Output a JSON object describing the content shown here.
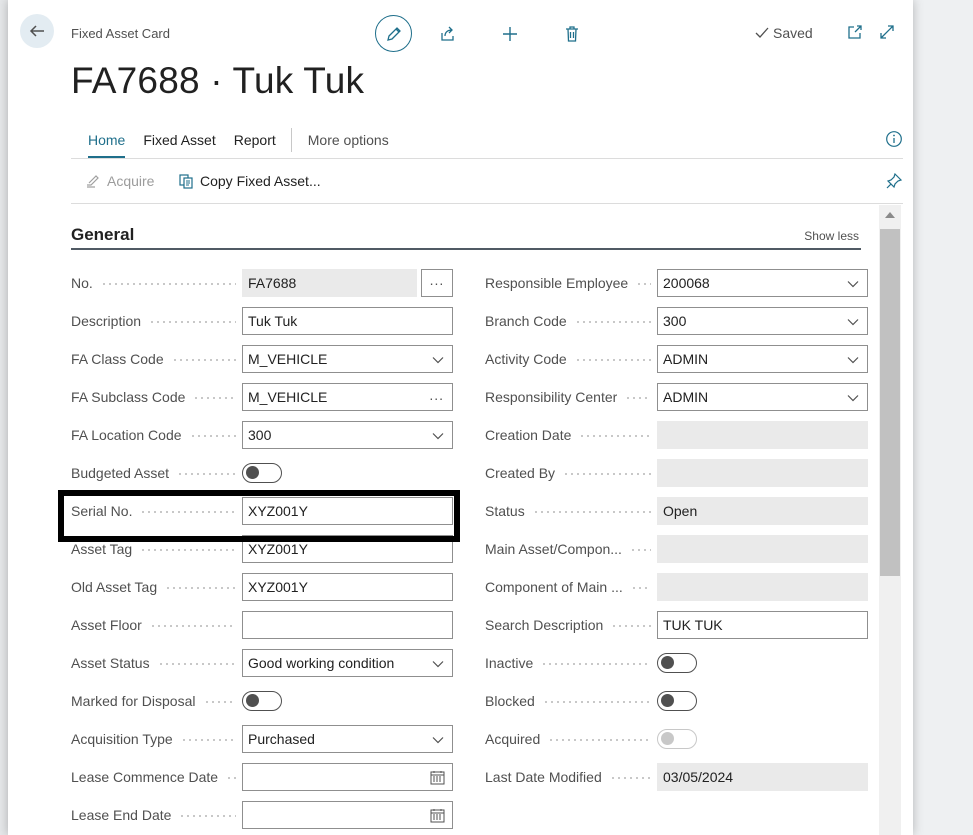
{
  "header": {
    "breadcrumb": "Fixed Asset Card",
    "title": "FA7688 · Tuk Tuk",
    "saved_label": "Saved"
  },
  "tabs": [
    {
      "label": "Home",
      "active": true
    },
    {
      "label": "Fixed Asset",
      "active": false
    },
    {
      "label": "Report",
      "active": false
    },
    {
      "label": "More options",
      "active": false
    }
  ],
  "actions": {
    "acquire": "Acquire",
    "copy": "Copy Fixed Asset..."
  },
  "section": {
    "title": "General",
    "toggle_label": "Show less"
  },
  "left_fields": [
    {
      "label": "No.",
      "value": "FA7688",
      "kind": "readonly-assist"
    },
    {
      "label": "Description",
      "value": "Tuk Tuk",
      "kind": "text"
    },
    {
      "label": "FA Class Code",
      "value": "M_VEHICLE",
      "kind": "dropdown"
    },
    {
      "label": "FA Subclass Code",
      "value": "M_VEHICLE",
      "kind": "lookup"
    },
    {
      "label": "FA Location Code",
      "value": "300",
      "kind": "dropdown"
    },
    {
      "label": "Budgeted Asset",
      "value": "",
      "kind": "toggle"
    },
    {
      "label": "Serial No.",
      "value": "XYZ001Y",
      "kind": "text"
    },
    {
      "label": "Asset Tag",
      "value": "XYZ001Y",
      "kind": "text"
    },
    {
      "label": "Old Asset Tag",
      "value": "XYZ001Y",
      "kind": "text"
    },
    {
      "label": "Asset Floor",
      "value": "",
      "kind": "text"
    },
    {
      "label": "Asset Status",
      "value": "Good working condition",
      "kind": "dropdown"
    },
    {
      "label": "Marked for Disposal",
      "value": "",
      "kind": "toggle"
    },
    {
      "label": "Acquisition Type",
      "value": "Purchased",
      "kind": "dropdown"
    },
    {
      "label": "Lease Commence Date",
      "value": "",
      "kind": "date"
    },
    {
      "label": "Lease End Date",
      "value": "",
      "kind": "date"
    }
  ],
  "right_fields": [
    {
      "label": "Responsible Employee",
      "value": "200068",
      "kind": "dropdown"
    },
    {
      "label": "Branch Code",
      "value": "300",
      "kind": "dropdown"
    },
    {
      "label": "Activity Code",
      "value": "ADMIN",
      "kind": "dropdown"
    },
    {
      "label": "Responsibility Center",
      "value": "ADMIN",
      "kind": "dropdown"
    },
    {
      "label": "Creation Date",
      "value": "",
      "kind": "readonly"
    },
    {
      "label": "Created By",
      "value": "",
      "kind": "readonly"
    },
    {
      "label": "Status",
      "value": "Open",
      "kind": "readonly"
    },
    {
      "label": "Main Asset/Compon...",
      "value": "",
      "kind": "readonly"
    },
    {
      "label": "Component of Main ...",
      "value": "",
      "kind": "readonly"
    },
    {
      "label": "Search Description",
      "value": "TUK TUK",
      "kind": "text"
    },
    {
      "label": "Inactive",
      "value": "",
      "kind": "toggle"
    },
    {
      "label": "Blocked",
      "value": "",
      "kind": "toggle"
    },
    {
      "label": "Acquired",
      "value": "",
      "kind": "toggle-disabled"
    },
    {
      "label": "Last Date Modified",
      "value": "03/05/2024",
      "kind": "readonly"
    }
  ],
  "icons": {
    "back": "arrow-left-icon",
    "edit": "pencil-icon",
    "share": "share-icon",
    "new": "plus-icon",
    "delete": "trash-icon",
    "saved": "check-icon",
    "open_new_window": "open-new-window-icon",
    "expand": "expand-icon",
    "info": "info-icon",
    "pin": "pin-icon"
  },
  "colors": {
    "accent": "#1f6f8b",
    "highlight": "#000000"
  }
}
